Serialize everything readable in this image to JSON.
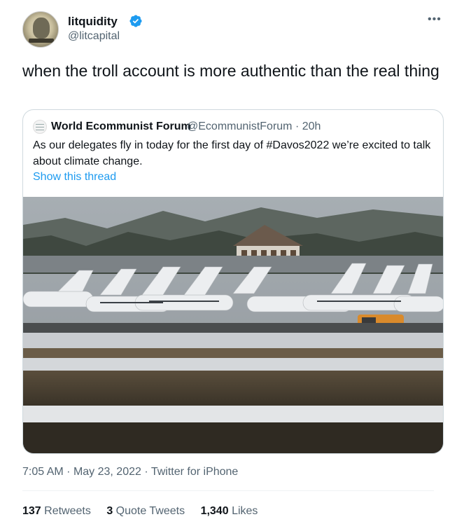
{
  "author": {
    "display_name": "litquidity",
    "handle": "@litcapital",
    "verified": true,
    "verified_color": "#1d9bf0"
  },
  "tweet": {
    "text": "when the troll account is more authentic than the real thing",
    "more_icon": "more-horizontal-icon"
  },
  "quoted": {
    "display_name": "World Ecommunist Forum",
    "handle_time": "@EcommunistForum · 20h",
    "text": "As our delegates fly in today for the first day of #Davos2022 we’re excited to talk about climate change.",
    "show_thread": "Show this thread",
    "link_color": "#1d9bf0",
    "image_description_icon": "photo-private-jets-on-snowy-airfield"
  },
  "meta": {
    "time": "7:05 AM",
    "date": "May 23, 2022",
    "source": "Twitter for iPhone"
  },
  "stats": {
    "retweets_count": "137",
    "retweets_label": "Retweets",
    "quotes_count": "3",
    "quotes_label": "Quote Tweets",
    "likes_count": "1,340",
    "likes_label": "Likes"
  }
}
